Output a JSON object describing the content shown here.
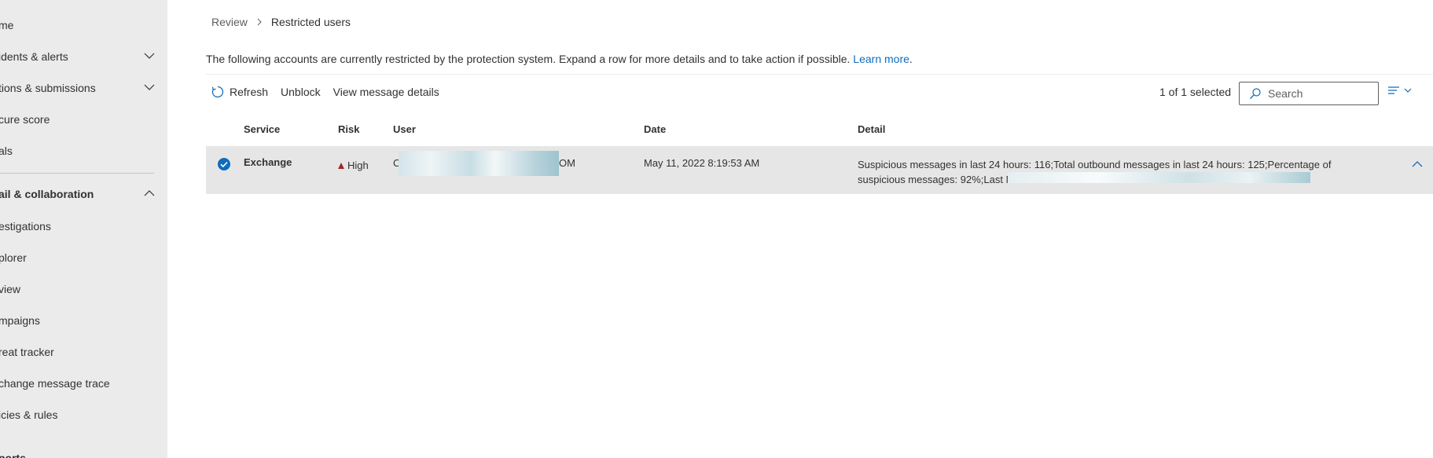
{
  "sidebar": {
    "items": [
      {
        "label": "me",
        "chevron": false
      },
      {
        "label": "idents & alerts",
        "chevron": "down"
      },
      {
        "label": "tions & submissions",
        "chevron": "down"
      },
      {
        "label": "cure score",
        "chevron": false
      },
      {
        "label": "als",
        "chevron": false
      },
      {
        "label": "ail & collaboration",
        "chevron": "up"
      },
      {
        "label": "estigations",
        "chevron": false
      },
      {
        "label": "plorer",
        "chevron": false
      },
      {
        "label": "view",
        "chevron": false
      },
      {
        "label": "mpaigns",
        "chevron": false
      },
      {
        "label": "reat tracker",
        "chevron": false
      },
      {
        "label": "change message trace",
        "chevron": false
      },
      {
        "label": "icies & rules",
        "chevron": false
      },
      {
        "label": "ports",
        "chevron": false
      }
    ]
  },
  "breadcrumb": {
    "parent": "Review",
    "current": "Restricted users"
  },
  "info": {
    "text": "The following accounts are currently restricted by the protection system. Expand a row for more details and to take action if possible.",
    "link": "Learn more"
  },
  "toolbar": {
    "refresh": "Refresh",
    "unblock": "Unblock",
    "view_details": "View message details"
  },
  "selection": {
    "count_text": "1 of 1 selected"
  },
  "search": {
    "placeholder": "Search"
  },
  "table": {
    "columns": {
      "service": "Service",
      "risk": "Risk",
      "user": "User",
      "date": "Date",
      "detail": "Detail"
    },
    "rows": [
      {
        "service": "Exchange",
        "risk": "High",
        "user_prefix": "C",
        "user_suffix": "OM",
        "date": "May 11, 2022 8:19:53 AM",
        "detail": "Suspicious messages in last 24 hours: 116;Total outbound messages in last 24 hours: 125;Percentage of suspicious messages: 92%;Last M"
      }
    ]
  },
  "colors": {
    "accent": "#0f6cbd",
    "risk_high": "#a4262c",
    "sidebar_bg": "#ebebeb",
    "row_selected": "#e6e6e6"
  }
}
